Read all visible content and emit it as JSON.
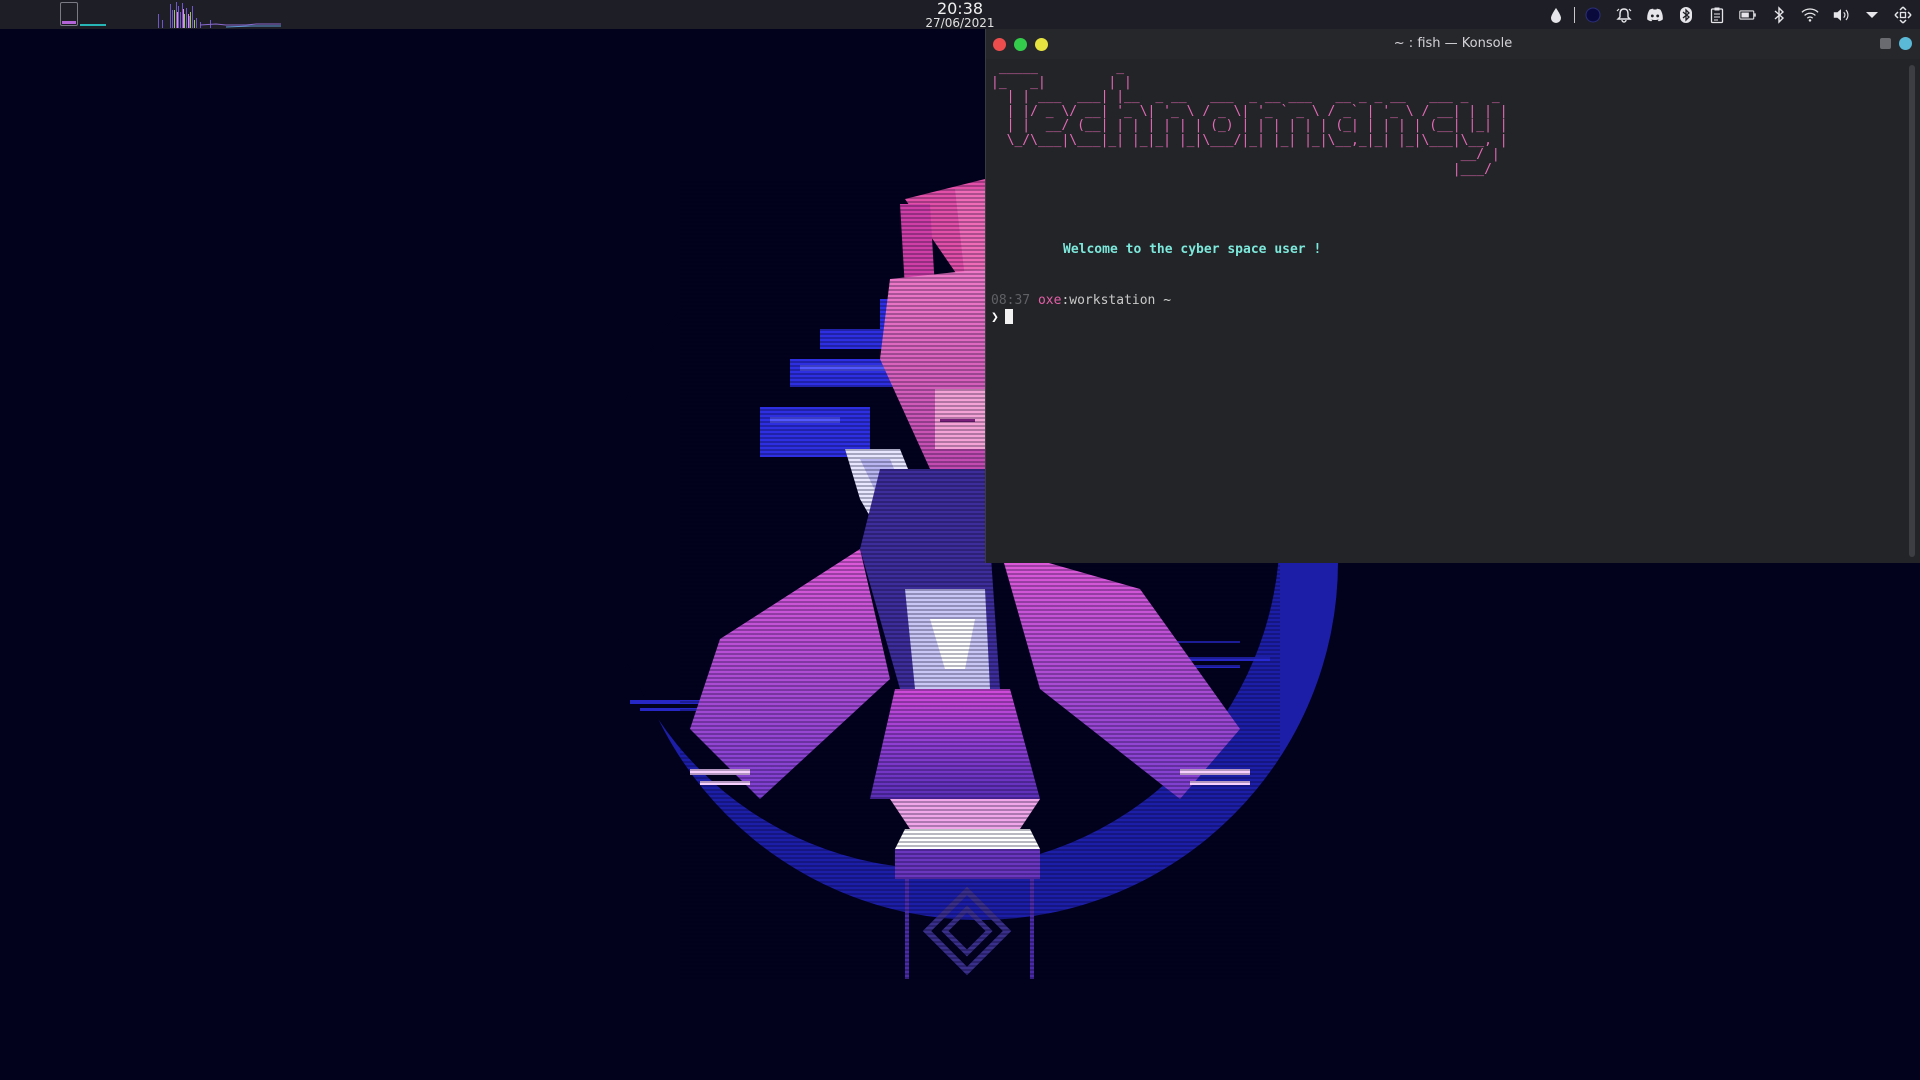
{
  "panel": {
    "clock_time": "20:38",
    "clock_date": "27/06/2021",
    "tray_icons": [
      "droplet-icon",
      "night-color-icon",
      "notification-bell-icon",
      "discord-icon",
      "bluetooth-icon",
      "clipboard-icon",
      "battery-icon",
      "bluetooth-settings-icon",
      "wifi-icon",
      "volume-icon",
      "expand-tray-icon",
      "network-icon"
    ]
  },
  "window": {
    "title": "~ : fish — Konsole"
  },
  "terminal": {
    "banner_ascii": " _____          _                                                \n|_   _|        | |                                               \n  | | ___  ___| |__  _ __   ___  _ __ ___   __ _ _ __   ___ _   _\n  | |/ _ \\/ __| '_ \\| '_ \\ / _ \\| '_ ` _ \\ / _` | '_ \\ / __| | | |\n  | |  __/ (__| | | | | | | (_) | | | | | | (_| | | | | (__| |_| |\n  \\_/\\___|\\___|_| |_|_| |_|\\___/|_| |_| |_|\\__,_|_| |_|\\___|\\__, |\n                                                            __/ |\n                                                           |___/ ",
    "welcome": "Welcome to the cyber space user !",
    "prompt_time": "08:37",
    "prompt_user": "oxe",
    "prompt_colon": ":",
    "prompt_host": "workstation",
    "prompt_dir": "~",
    "prompt_symbol": "❯"
  },
  "colors": {
    "desktop_bg": "#02021c",
    "terminal_bg": "#232427",
    "ascii_pink": "#e469b7",
    "welcome_teal": "#7de8dc"
  }
}
